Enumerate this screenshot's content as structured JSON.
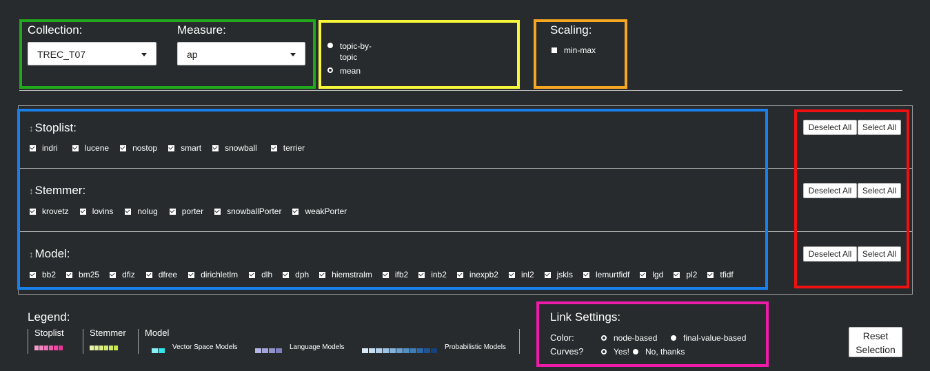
{
  "collection": {
    "label": "Collection:",
    "value": "TREC_T07"
  },
  "measure": {
    "label": "Measure:",
    "value": "ap"
  },
  "view": {
    "options": [
      {
        "label": "topic-by-topic",
        "selected": true
      },
      {
        "label": "mean",
        "selected": false
      }
    ]
  },
  "scaling": {
    "label": "Scaling:",
    "option": "min-max",
    "checked": true
  },
  "groups": [
    {
      "title": "Stoplist:",
      "items": [
        "indri",
        "lucene",
        "nostop",
        "smart",
        "snowball",
        "terrier"
      ]
    },
    {
      "title": "Stemmer:",
      "items": [
        "krovetz",
        "lovins",
        "nolug",
        "porter",
        "snowballPorter",
        "weakPorter"
      ]
    },
    {
      "title": "Model:",
      "items": [
        "bb2",
        "bm25",
        "dfiz",
        "dfree",
        "dirichletlm",
        "dlh",
        "dph",
        "hiemstralm",
        "ifb2",
        "inb2",
        "inexpb2",
        "inl2",
        "jskls",
        "lemurtfidf",
        "lgd",
        "pl2",
        "tfidf"
      ]
    }
  ],
  "buttons": {
    "deselect_all": "Deselect All",
    "select_all": "Select All",
    "reset": "Reset Selection"
  },
  "legend": {
    "title": "Legend:",
    "stoplist": "Stoplist",
    "stemmer": "Stemmer",
    "model": "Model",
    "vsm": "Vector Space Models",
    "lm": "Language Models",
    "pm": "Probabilistic Models"
  },
  "link_settings": {
    "title": "Link Settings:",
    "color_label": "Color:",
    "color_options": [
      {
        "label": "node-based",
        "selected": false
      },
      {
        "label": "final-value-based",
        "selected": true
      }
    ],
    "curves_label": "Curves?",
    "curves_options": [
      {
        "label": "Yes!",
        "selected": false
      },
      {
        "label": "No, thanks",
        "selected": true
      }
    ]
  },
  "colors": {
    "green_frame": "#22a81c",
    "yellow_frame": "#f6f63a",
    "orange_frame": "#f5a623",
    "blue_frame": "#1a7fe8",
    "red_frame": "#ee1111",
    "magenta_frame": "#ee1aa8",
    "stoplist_swatch": "#ee3fa0",
    "stemmer_swatch": "#d4ee6a",
    "vsm_swatch": "#2ee6ee",
    "lm_swatch": "#8f8fcc",
    "pm_swatch": "#3a7abf"
  }
}
